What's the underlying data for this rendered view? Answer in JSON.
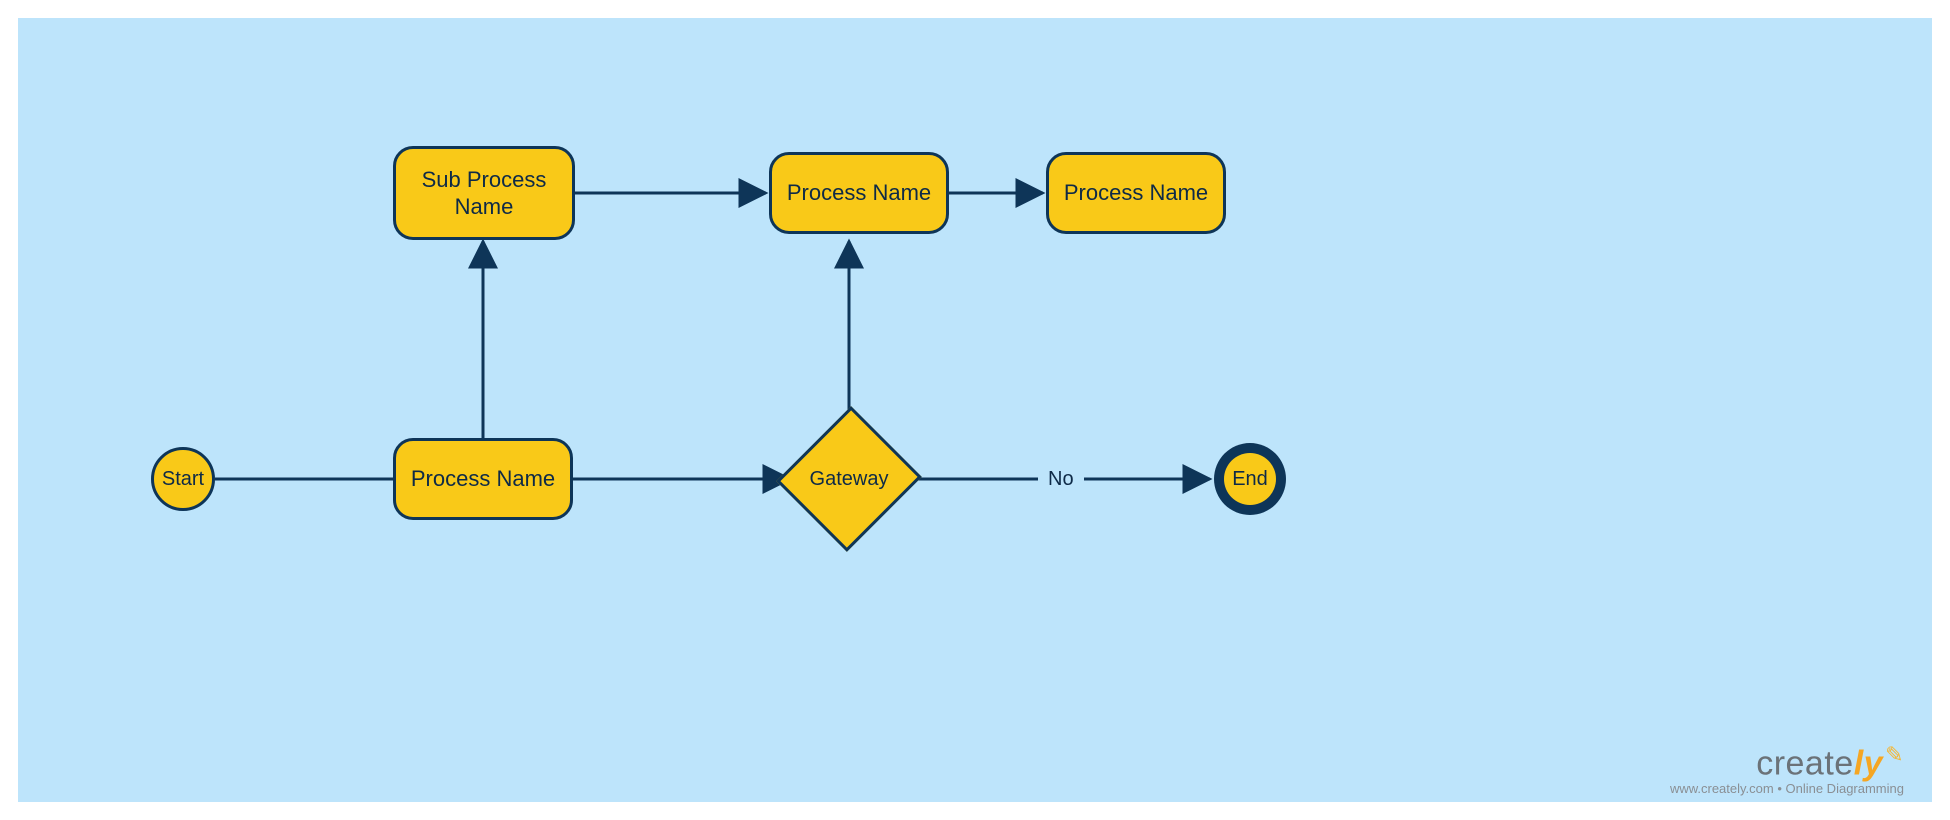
{
  "nodes": {
    "start": {
      "label": "Start"
    },
    "process_main": {
      "label": "Process Name"
    },
    "sub_process": {
      "label": "Sub Process\nName"
    },
    "process_top_mid": {
      "label": "Process Name"
    },
    "process_top_right": {
      "label": "Process Name"
    },
    "gateway": {
      "label": "Gateway"
    },
    "end": {
      "label": "End"
    }
  },
  "edges": {
    "gateway_no": {
      "label": "No"
    }
  },
  "watermark": {
    "brand_part1": "create",
    "brand_part2": "ly",
    "subtitle": "www.creately.com • Online Diagramming"
  }
}
